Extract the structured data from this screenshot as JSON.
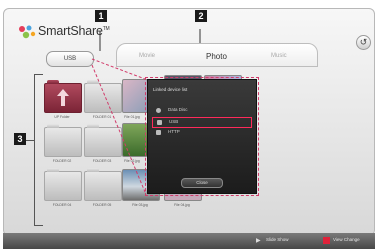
{
  "app": {
    "brand": "SmartShare",
    "trademark": "TM"
  },
  "source_selector": {
    "label": "USB"
  },
  "tabs": [
    {
      "label": "Movie",
      "active": false
    },
    {
      "label": "Photo",
      "active": true
    },
    {
      "label": "Music",
      "active": false
    }
  ],
  "markers": {
    "one": "1",
    "two": "2",
    "three": "3"
  },
  "icons": {
    "back": "↺",
    "play": "▶"
  },
  "grid": {
    "items": [
      {
        "label": "UP Folder",
        "kind": "up-folder"
      },
      {
        "label": "FOLDER 01",
        "kind": "folder"
      },
      {
        "label": "File 01.jpg",
        "kind": "photo"
      },
      {
        "label": "FOLDER 02",
        "kind": "folder"
      },
      {
        "label": "FOLDER 03",
        "kind": "folder"
      },
      {
        "label": "File 02.jpg",
        "kind": "photo"
      },
      {
        "label": "FOLDER 04",
        "kind": "folder"
      },
      {
        "label": "FOLDER 05",
        "kind": "folder"
      },
      {
        "label": "File 03.jpg",
        "kind": "photo"
      },
      {
        "label": "File 04.jpg",
        "kind": "photo"
      }
    ]
  },
  "device_dialog": {
    "title": "Linked device list",
    "devices": [
      {
        "label": "Data Disc",
        "selected": false
      },
      {
        "label": "USB",
        "selected": true
      },
      {
        "label": "HTTP",
        "selected": false
      }
    ],
    "close_label": "Close"
  },
  "bottom_bar": {
    "slide_show": "Slide Show",
    "view_change": "View Change",
    "accent_red": "#e0223a"
  },
  "colors": {
    "highlight": "#ff2a5a",
    "dashed": "#d13b6a"
  }
}
